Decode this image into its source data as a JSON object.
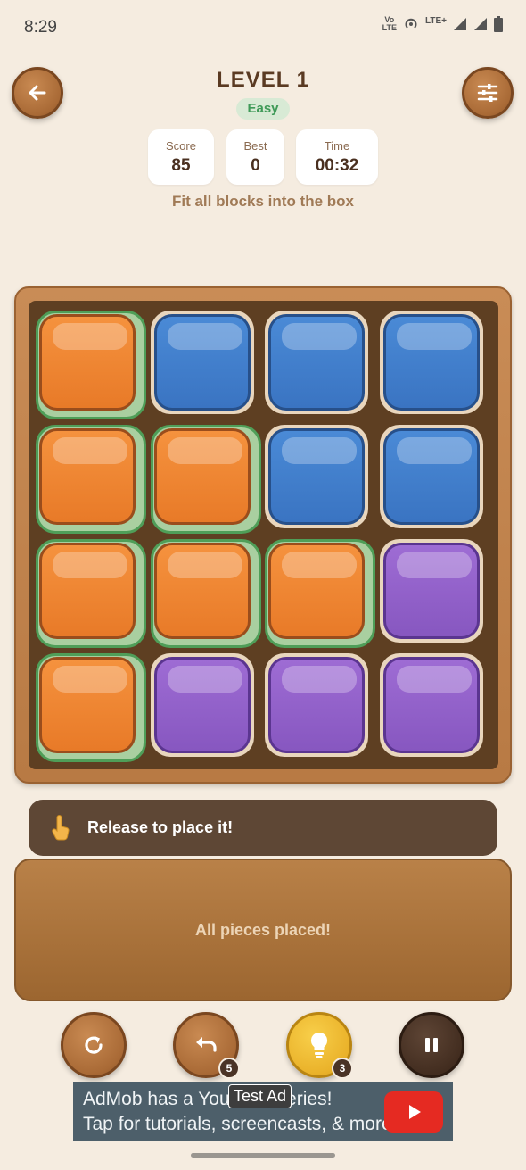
{
  "status_bar": {
    "time": "8:29",
    "volte": "Vo LTE",
    "lte": "LTE+"
  },
  "header": {
    "title": "LEVEL 1",
    "difficulty": "Easy"
  },
  "stats": [
    {
      "label": "Score",
      "value": "85"
    },
    {
      "label": "Best",
      "value": "0"
    },
    {
      "label": "Time",
      "value": "00:32"
    }
  ],
  "instruction": "Fit all blocks into the box",
  "board": {
    "rows": 4,
    "cols": 4,
    "cells": [
      [
        "orange-placed",
        "blue",
        "blue",
        "blue"
      ],
      [
        "orange-placed",
        "orange-placed",
        "blue",
        "blue"
      ],
      [
        "orange-placed",
        "orange-placed",
        "orange-placed",
        "purple"
      ],
      [
        "orange-placed",
        "purple",
        "purple",
        "purple"
      ]
    ]
  },
  "toast": {
    "text": "Release to place it!",
    "icon": "pointing-hand-icon"
  },
  "tray": {
    "text": "All pieces placed!"
  },
  "controls": {
    "undo_count": "5",
    "hint_count": "3"
  },
  "ad": {
    "line1": "AdMob has a YouTube series!",
    "line2": "Tap for tutorials, screencasts, & more.",
    "label": "Test Ad"
  },
  "colors": {
    "orange": "#f0842e",
    "blue": "#3f7fcc",
    "purple": "#9261ca",
    "placed_highlight": "#a9cfa0"
  }
}
